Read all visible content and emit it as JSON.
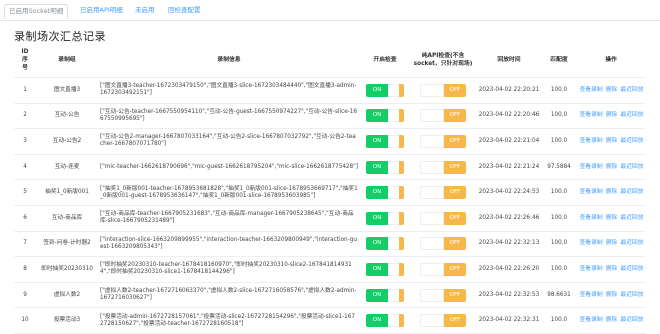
{
  "tabs": [
    "已启用Socket明细",
    "已启用API明细",
    "未启用",
    "回检查配置"
  ],
  "page_title": "录制场次汇总记录",
  "columns": {
    "id": "ID\n序\n号",
    "group": "录制组",
    "info": "录制信息",
    "check": "开启检查",
    "api_check": "纯API检查(不含socket，只针对现场)",
    "time": "回放时间",
    "match": "匹配度",
    "ops": "操作"
  },
  "switch_labels": {
    "on": "ON",
    "off": "OFF"
  },
  "actions": {
    "view": "查看录制",
    "delete": "删除",
    "recent": "最近回放"
  },
  "rows": [
    {
      "id": "1",
      "group": "图文直播3",
      "info": "[\"图文直播3-teacher-1672303479150\",\"图文直播3-slice-1672303484440\",\"图文直播3-admin-1672303492151\"]",
      "time": "2023-04-02 22:20:21",
      "match": "100.0"
    },
    {
      "id": "2",
      "group": "互动-公告",
      "info": "[\"互动-公告-teacher-1667550954110\",\"互动-公告-guest-1667550974227\",\"互动-公告-slice-1667550995695\"]",
      "time": "2023-04-02 22:20:46",
      "match": "100.0"
    },
    {
      "id": "3",
      "group": "互动-公告2",
      "info": "[\"互动-公告2-manager-1667807033164\",\"互动-公告2-slice-1667807032792\",\"互动-公告2-teacher-1667807071780\"]",
      "time": "2023-04-02 22:21:04",
      "match": "100.0"
    },
    {
      "id": "4",
      "group": "互动-连麦",
      "info": "[\"mic-teacher-1662618790696\",\"mic-guest-1662618795204\",\"mic-slice-1662618775428\"]",
      "time": "2023-04-02 22:21:24",
      "match": "97.5884"
    },
    {
      "id": "5",
      "group": "抽奖1_0新版001",
      "info": "[\"抽奖1_0新版001-teacher-1678953681828\",\"抽奖1_0新版001-slice-1678953669717\",\"抽奖1_0新版001-guest-1678953636147\",\"抽奖1_0新版001-slice-1678953603985\"]",
      "time": "2023-04-02 22:24:53",
      "match": "100.0"
    },
    {
      "id": "6",
      "group": "互动-商品库",
      "info": "[\"互动-商品库-teacher-1667905231683\",\"互动-商品库-manager-1667905238645\",\"互动-商品库-slice-1667905231489\"]",
      "time": "2023-04-02 22:26:46",
      "match": "100.0"
    },
    {
      "id": "7",
      "group": "签到-问卷-计时器2",
      "info": "[\"interaction-slice-1663209899955\",\"interaction-teacher-1663209800949\",\"interaction-guest-1663209805343\"]",
      "time": "2023-04-02 22:32:13",
      "match": "100.0"
    },
    {
      "id": "8",
      "group": "即时抽奖20230310",
      "info": "[\"即时抽奖20230310-teacher-1678418160970\",\"即时抽奖20230310-slice2-1678418149314\",\"即时抽奖20230310-slice1-1678418144296\"]",
      "time": "2023-04-02 22:26:20",
      "match": "100.0"
    },
    {
      "id": "9",
      "group": "虚拟人数2",
      "info": "[\"虚拟人数2-teacher-1672716063370\",\"虚拟人数2-slice-1672716058576\",\"虚拟人数2-admin-1672716030627\"]",
      "time": "2023-04-02 22:32:53",
      "match": "98.6631"
    },
    {
      "id": "10",
      "group": "投票活动3",
      "info": "[\"投票活动-admin-1672728157061\",\"投票活动-slice2-1672728154296\",\"投票活动-slice1-1672728150627\",\"投票活动-teacher-1672728160518\"]",
      "time": "2023-04-02 22:32:31",
      "match": "100.0"
    }
  ]
}
